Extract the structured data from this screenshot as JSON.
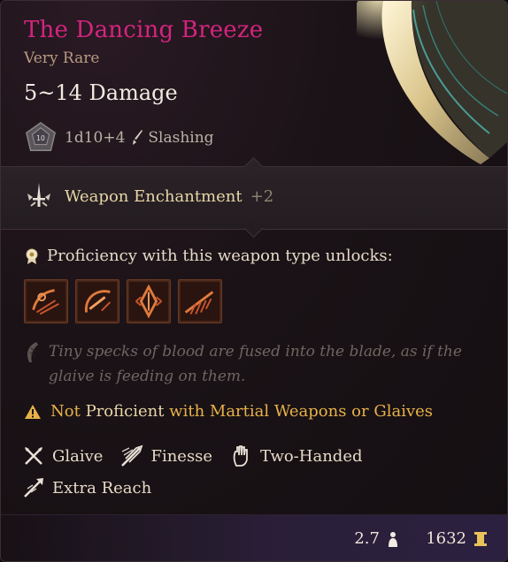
{
  "item": {
    "name": "The Dancing Breeze",
    "rarity": "Very Rare",
    "damage": "5~14 Damage",
    "dice": "1d10+4",
    "damage_type": "Slashing",
    "dice_face": "10"
  },
  "enchantment": {
    "label": "Weapon Enchantment",
    "value": "+2"
  },
  "proficiency": {
    "text": "Proficiency with this weapon type unlocks:",
    "actions": [
      "action-1",
      "action-2",
      "action-3",
      "action-4"
    ]
  },
  "description": "Tiny specks of blood are fused into the blade, as if the glaive is feeding on them.",
  "warning": {
    "not": "Not",
    "proficient": "Proficient",
    "rest": "with Martial Weapons or Glaives"
  },
  "properties": {
    "glaive": "Glaive",
    "finesse": "Finesse",
    "two_handed": "Two-Handed",
    "extra_reach": "Extra Reach"
  },
  "footer": {
    "weight": "2.7",
    "value": "1632"
  },
  "colors": {
    "title": "#d4247f",
    "rarity": "#b99a82",
    "warning": "#e8b24a",
    "action_border": "#6b3a23"
  }
}
